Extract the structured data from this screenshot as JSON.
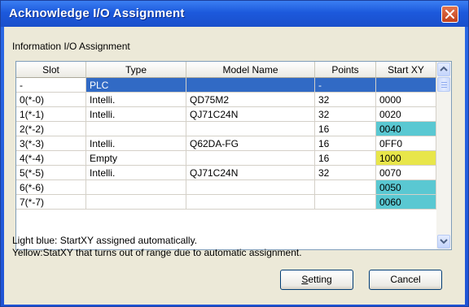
{
  "window": {
    "title": "Acknowledge I/O Assignment"
  },
  "group": {
    "label": "Information I/O Assignment"
  },
  "table": {
    "columns": [
      "Slot",
      "Type",
      "Model Name",
      "Points",
      "Start XY"
    ],
    "rows": [
      {
        "slot": "-",
        "type": "PLC",
        "model": "",
        "points": "-",
        "start": "",
        "selected": true
      },
      {
        "slot": "0(*-0)",
        "type": "Intelli.",
        "model": "QD75M2",
        "points": "32",
        "start": "0000"
      },
      {
        "slot": "1(*-1)",
        "type": "Intelli.",
        "model": "QJ71C24N",
        "points": "32",
        "start": "0020"
      },
      {
        "slot": "2(*-2)",
        "type": "",
        "model": "",
        "points": "16",
        "start": "0040",
        "highlight": "light-blue"
      },
      {
        "slot": "3(*-3)",
        "type": "Intelli.",
        "model": "Q62DA-FG",
        "points": "16",
        "start": "0FF0"
      },
      {
        "slot": "4(*-4)",
        "type": "Empty",
        "model": "",
        "points": "16",
        "start": "1000",
        "highlight": "yellow"
      },
      {
        "slot": "5(*-5)",
        "type": "Intelli.",
        "model": "QJ71C24N",
        "points": "32",
        "start": "0070"
      },
      {
        "slot": "6(*-6)",
        "type": "",
        "model": "",
        "points": "",
        "start": "0050",
        "highlight": "light-blue"
      },
      {
        "slot": "7(*-7)",
        "type": "",
        "model": "",
        "points": "",
        "start": "0060",
        "highlight": "light-blue"
      }
    ]
  },
  "notes": {
    "line1": "Light blue: StartXY assigned automatically.",
    "line2": "Yellow:StatXY that turns out of range due to automatic assignment."
  },
  "buttons": {
    "setting_mnemonic": "S",
    "setting_rest": "etting",
    "cancel": "Cancel"
  },
  "colors": {
    "titlebar": "#1f54d6",
    "selection": "#316ac5",
    "light_blue": "#5ac8d2",
    "yellow": "#e8e64a",
    "dialog_bg": "#ece9d8"
  },
  "icons": {
    "close": "close-icon",
    "scroll_up": "chevron-up-icon",
    "scroll_down": "chevron-down-icon"
  }
}
